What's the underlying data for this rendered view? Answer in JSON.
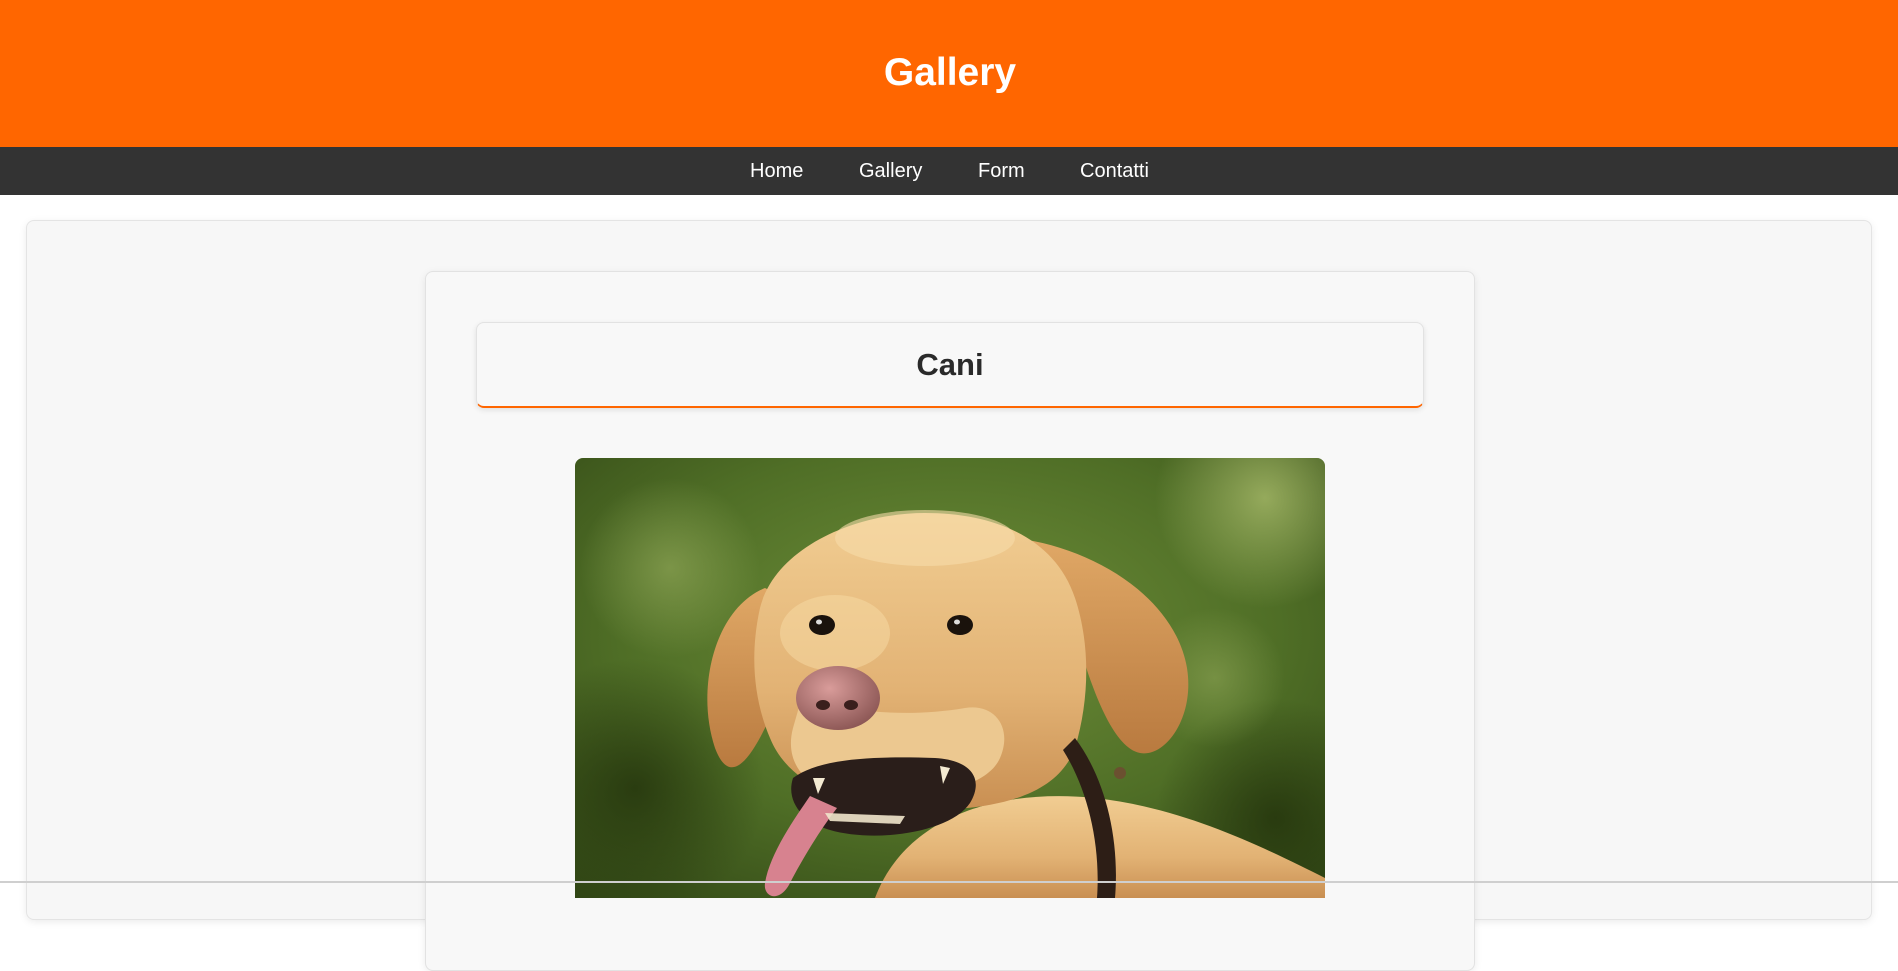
{
  "header": {
    "title": "Gallery",
    "background_color": "#ff6600"
  },
  "nav": {
    "background_color": "#333333",
    "items": [
      {
        "label": "Home"
      },
      {
        "label": "Gallery"
      },
      {
        "label": "Form"
      },
      {
        "label": "Contatti"
      }
    ]
  },
  "gallery": {
    "section_title": "Cani",
    "accent_color": "#ff6600",
    "image": {
      "subject": "golden labrador dog photo",
      "icon": "dog-photo"
    }
  }
}
